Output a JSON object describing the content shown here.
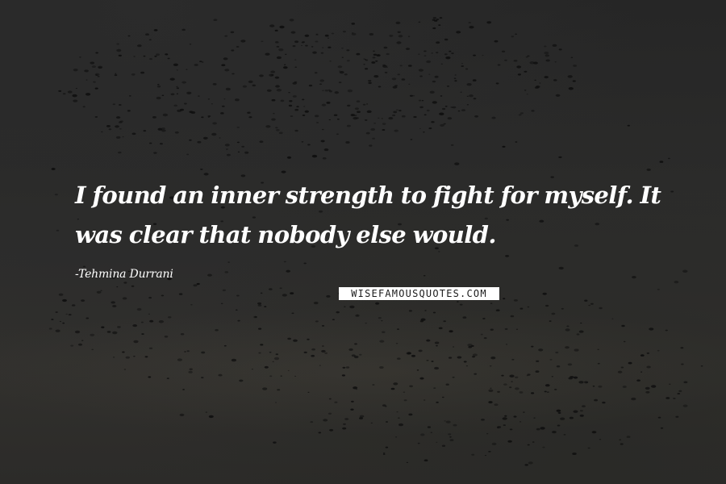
{
  "quote": {
    "text": "I found an inner strength to fight for myself. It was clear that nobody else would."
  },
  "author": {
    "text": "-Tehmina Durrani"
  },
  "watermark": {
    "text": "WISEFAMOUSQUOTES.COM"
  },
  "colors": {
    "text": "#ffffff",
    "background": "#2b2b2a",
    "birds": "#0f0f0f"
  }
}
